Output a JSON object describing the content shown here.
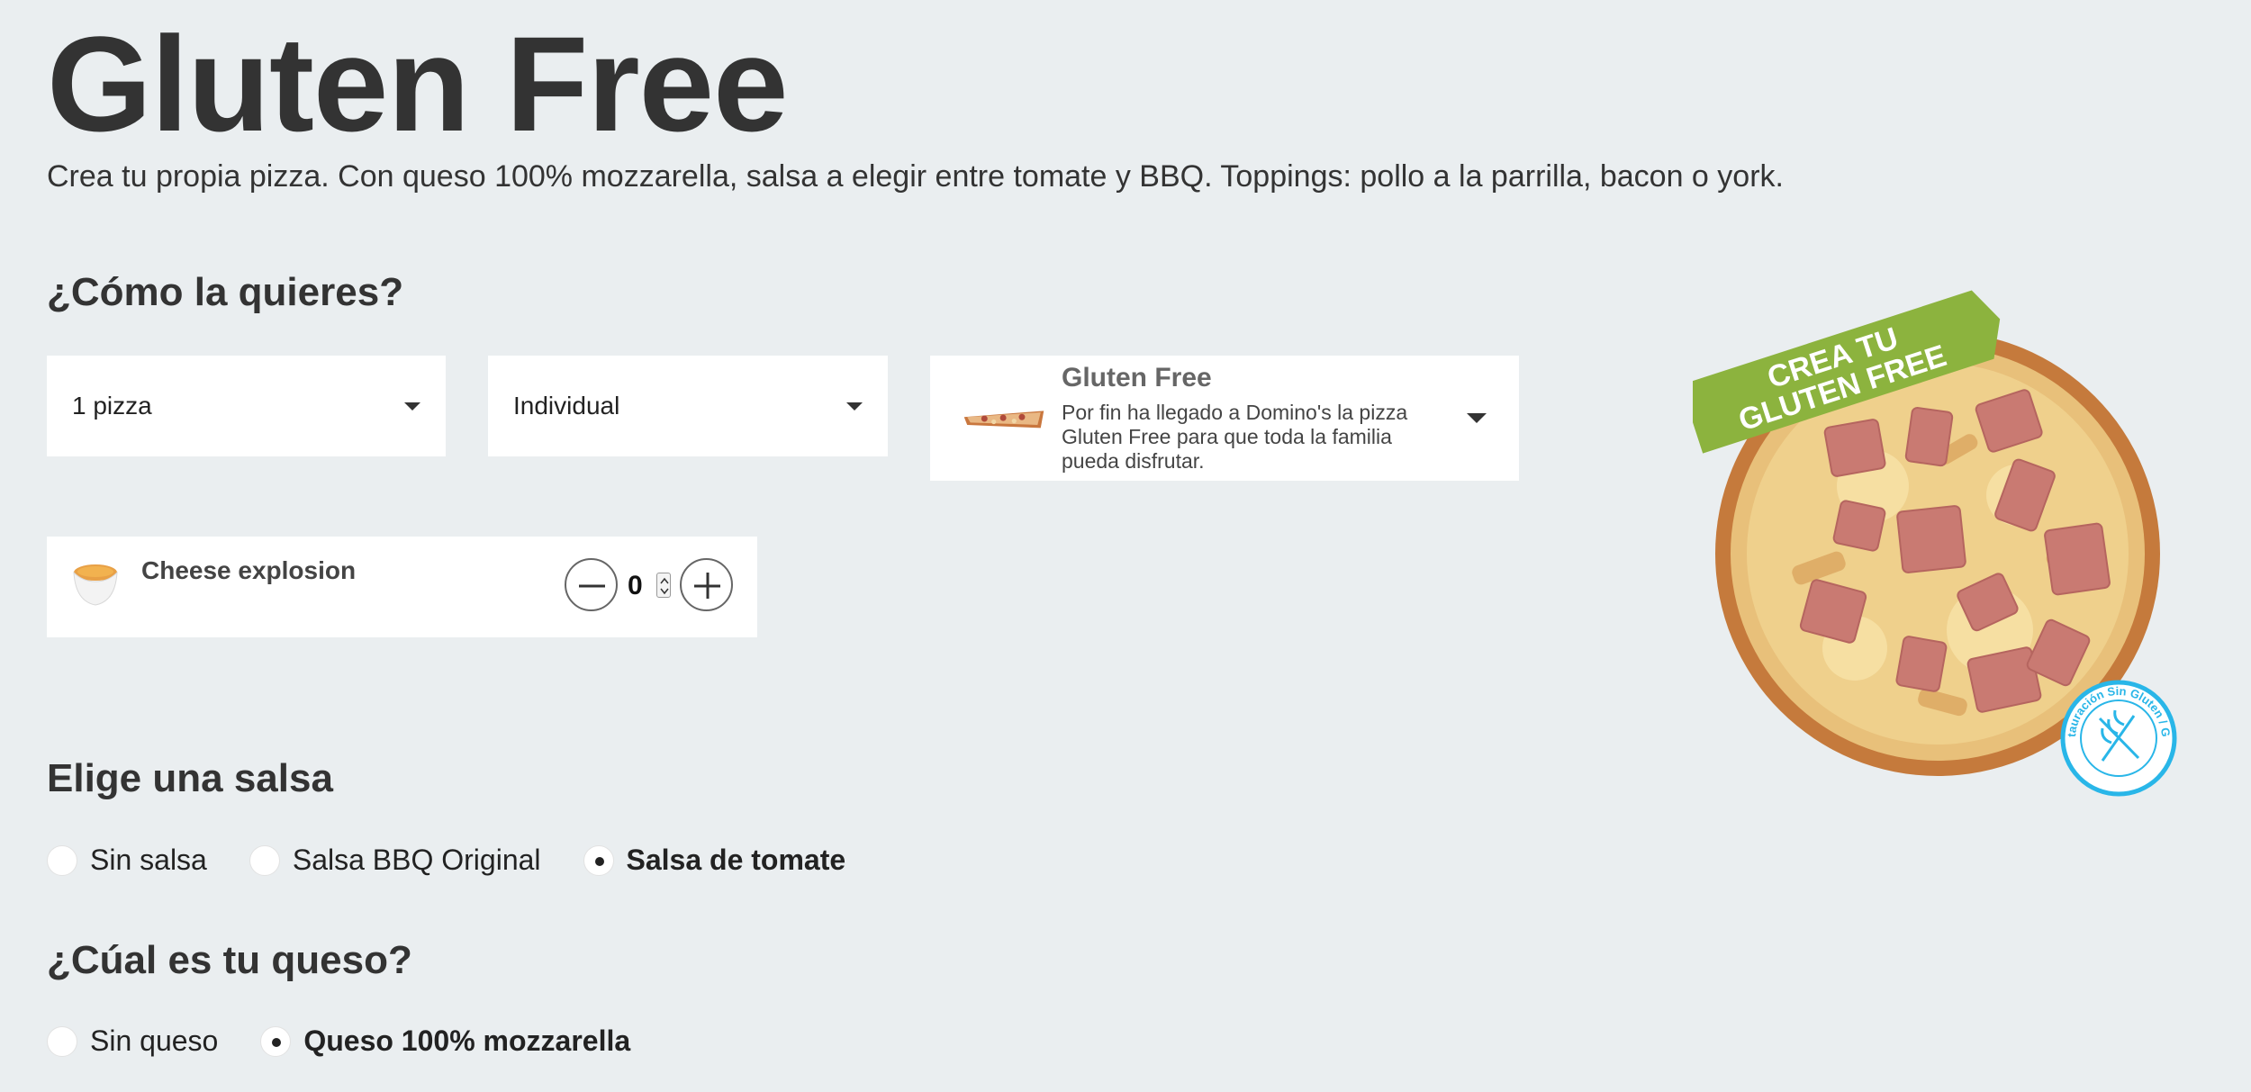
{
  "header": {
    "title": "Gluten Free",
    "description": "Crea tu propia pizza. Con queso 100% mozzarella, salsa a elegir entre tomate y BBQ. Toppings: pollo a la parrilla, bacon o york."
  },
  "order": {
    "section_title": "¿Cómo la quieres?",
    "quantity_select": "1 pizza",
    "size_select": "Individual",
    "crust": {
      "title": "Gluten Free",
      "description": "Por fin ha llegado a Domino's la pizza Gluten Free para que toda la familia pueda disfrutar."
    },
    "extra": {
      "name": "Cheese explosion",
      "quantity": "0"
    }
  },
  "sauce": {
    "section_title": "Elige una salsa",
    "options": [
      {
        "label": "Sin salsa",
        "selected": false
      },
      {
        "label": "Salsa BBQ Original",
        "selected": false
      },
      {
        "label": "Salsa de tomate",
        "selected": true
      }
    ]
  },
  "cheese": {
    "section_title": "¿Cúal es tu queso?",
    "options": [
      {
        "label": "Sin queso",
        "selected": false
      },
      {
        "label": "Queso 100% mozzarella",
        "selected": true
      }
    ]
  },
  "promo_image": {
    "banner_line1": "CREA TU",
    "banner_line2": "GLUTEN FREE",
    "badge_text": "FACE Restauración Sin Gluten / Gluten Free",
    "banner_color": "#8cb33e",
    "badge_color": "#29b6e8"
  }
}
